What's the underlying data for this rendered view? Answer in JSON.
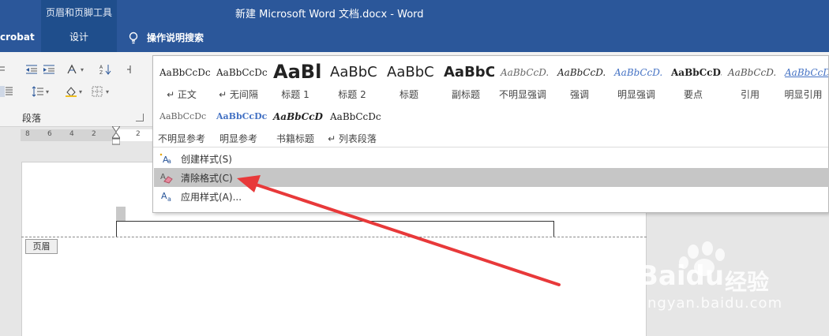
{
  "titlebar": {
    "context_tool_title": "页眉和页脚工具",
    "document_title": "新建 Microsoft Word 文档.docx  -  Word"
  },
  "tabs": {
    "acrobat": "crobat",
    "design": "设计",
    "tell_me": "操作说明搜索"
  },
  "ribbon": {
    "paragraph_group_label": "段落"
  },
  "ruler": {
    "numbers": [
      "8",
      "6",
      "4",
      "2",
      "2"
    ]
  },
  "styles_gallery": {
    "row1": [
      {
        "preview": "AaBbCcDc",
        "name": "↵ 正文"
      },
      {
        "preview": "AaBbCcDc",
        "name": "↵ 无间隔"
      },
      {
        "preview": "AaBl",
        "name": "标题 1"
      },
      {
        "preview": "AaBbC",
        "name": "标题 2"
      },
      {
        "preview": "AaBbC",
        "name": "标题"
      },
      {
        "preview": "AaBbC",
        "name": "副标题"
      },
      {
        "preview": "AaBbCcD.",
        "name": "不明显强调"
      },
      {
        "preview": "AaBbCcD.",
        "name": "强调"
      },
      {
        "preview": "AaBbCcD.",
        "name": "明显强调"
      },
      {
        "preview": "AaBbCcD.",
        "name": "要点"
      },
      {
        "preview": "AaBbCcD.",
        "name": "引用"
      },
      {
        "preview": "AaBbCcDc",
        "name": "明显引用"
      }
    ],
    "row2": [
      {
        "preview": "AaBbCcDc",
        "name": "不明显参考"
      },
      {
        "preview": "AaBbCcDc",
        "name": "明显参考"
      },
      {
        "preview": "AaBbCcD",
        "name": "书籍标题"
      },
      {
        "preview": "AaBbCcDc",
        "name": "↵ 列表段落"
      }
    ],
    "menu": {
      "create_style": "创建样式(S)",
      "clear_formatting": "清除格式(C)",
      "apply_styles": "应用样式(A)..."
    }
  },
  "document": {
    "header_tag": "页眉"
  },
  "watermark": {
    "logo": "Bai",
    "logo_du": "du",
    "cn": "经验",
    "url": "jingyan.baidu.com"
  },
  "colors": {
    "titlebar": "#2b579a",
    "context_band": "#1f4e8c",
    "hover_row": "#c6c6c6",
    "arrow": "#e8393a"
  },
  "icons": [
    "lightbulb-icon",
    "indent-icon",
    "sort-icon",
    "shading-icon",
    "border-icon",
    "create-style-icon",
    "clear-formatting-icon",
    "apply-styles-icon"
  ]
}
